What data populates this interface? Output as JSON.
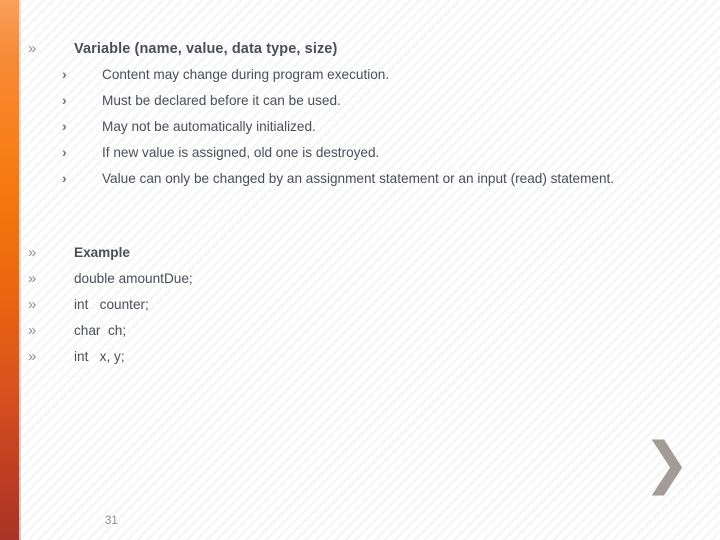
{
  "slide": {
    "page_number": "31",
    "accent_color_top": "#f9a15a",
    "accent_color_bottom": "#a93426",
    "text_color": "#4a4e57",
    "marker_color": "#8d8f95"
  },
  "markers": {
    "level1": "»",
    "level2": "›"
  },
  "section_variable": {
    "heading": "Variable (name, value, data type, size)",
    "bullets": [
      "Content may change during program execution.",
      "Must be declared before it can be used.",
      "May not be automatically initialized.",
      "If new value is assigned, old one is destroyed.",
      "Value can only be changed by an assignment statement or an input (read) statement."
    ]
  },
  "section_example": {
    "lines": [
      "Example",
      "double amountDue;",
      "int   counter;",
      "char  ch;",
      "int   x, y;"
    ]
  },
  "decoration": {
    "corner_chevron": "❯"
  }
}
